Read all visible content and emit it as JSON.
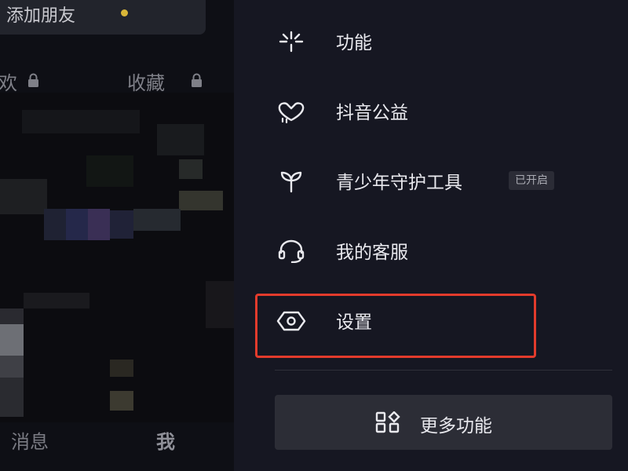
{
  "left_panel": {
    "add_friend": "添加朋友",
    "tabs": {
      "likes_partial": "欢",
      "favorites": "收藏"
    },
    "bottom_nav": {
      "messages": "消息",
      "me": "我"
    }
  },
  "menu": {
    "items": [
      {
        "label": "功能",
        "icon": "sparkle-icon"
      },
      {
        "label": "抖音公益",
        "icon": "heart-cloud-icon"
      },
      {
        "label": "青少年守护工具",
        "icon": "sprout-icon",
        "badge": "已开启"
      },
      {
        "label": "我的客服",
        "icon": "headset-icon"
      },
      {
        "label": "设置",
        "icon": "settings-hexagon-icon"
      }
    ],
    "more_button": {
      "label": "更多功能",
      "icon": "grid-shapes-icon"
    }
  },
  "colors": {
    "panel_bg": "#161722",
    "left_bg": "#0e0f15",
    "highlight_border": "#e33b2c",
    "notification_dot": "#d9b638",
    "text_primary": "#e9e9ee"
  }
}
